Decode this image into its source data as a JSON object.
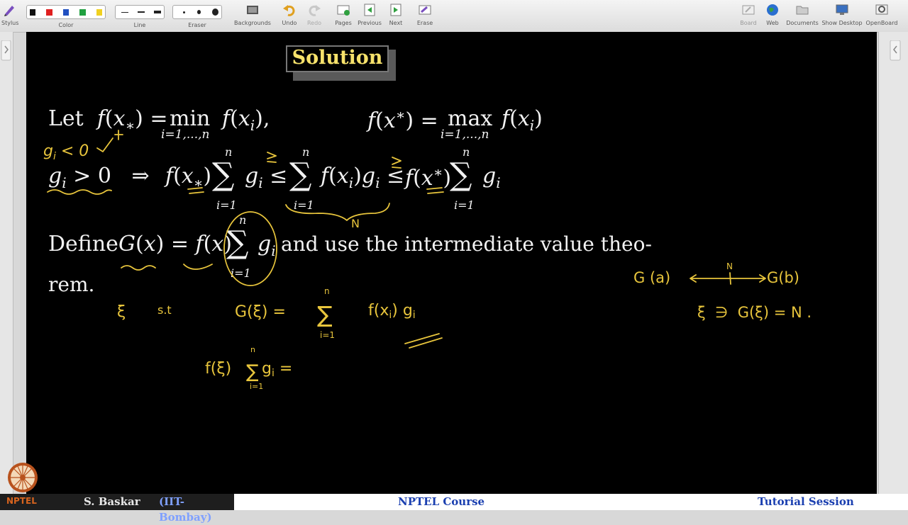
{
  "toolbar": {
    "stylus": "Stylus",
    "color": "Color",
    "line": "Line",
    "eraser": "Eraser",
    "backgrounds": "Backgrounds",
    "undo": "Undo",
    "redo": "Redo",
    "pages": "Pages",
    "previous": "Previous",
    "next": "Next",
    "erase": "Erase",
    "board": "Board",
    "web": "Web",
    "documents": "Documents",
    "show_desktop": "Show Desktop",
    "openboard": "OpenBoard",
    "colors": [
      "#111111",
      "#e02020",
      "#2050c0",
      "#20a040",
      "#f0d020"
    ]
  },
  "slide": {
    "title": "Solution",
    "let": "Let",
    "min": "min",
    "max": "max",
    "index_range": "i=1,...,n",
    "define": "Define",
    "and_use": "and use the intermediate value theo-",
    "rem": "rem."
  },
  "footer": {
    "author": "S. Baskar",
    "affiliation": "(IIT-Bombay)",
    "course": "NPTEL Course",
    "session": "Tutorial Session",
    "logo_text": "NPTEL"
  }
}
